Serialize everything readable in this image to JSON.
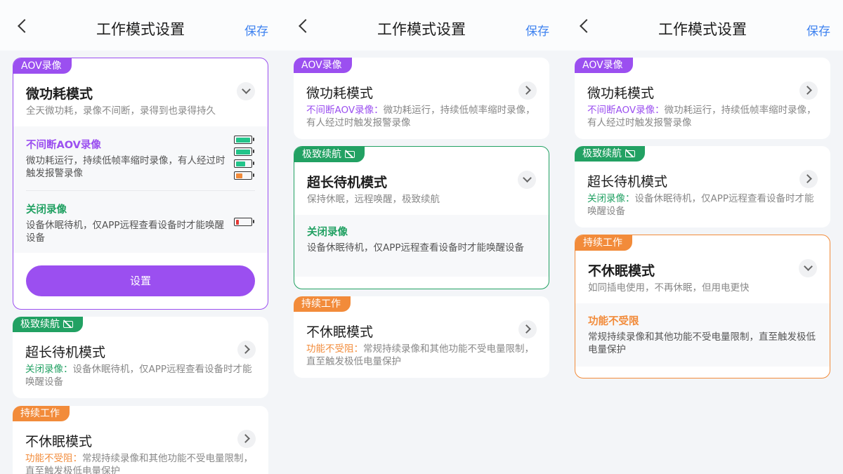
{
  "colors": {
    "purple": "#9b4ff0",
    "green": "#22a163",
    "orange": "#f28b3a",
    "link": "#3e82f0"
  },
  "nav": {
    "title": "工作模式设置",
    "save": "保存"
  },
  "aov": {
    "tag": "AOV录像",
    "title": "微功耗模式",
    "desc": "全天微功耗，录像不间断，录得到也录得持久",
    "highlight": "不间断AOV录像",
    "highlight_sep": "：",
    "summary": "微功耗运行，持续低帧率缩时录像，有人经过时触发报警录像",
    "opt1_title": "不间断AOV录像",
    "opt1_desc": "微功耗运行，持续低帧率缩时录像，有人经过时触发报警录像",
    "opt2_title": "关闭录像",
    "opt2_desc": "设备休眠待机，仅APP远程查看设备时才能唤醒设备",
    "button": "设置"
  },
  "standby": {
    "tag": "极致续航",
    "title": "超长待机模式",
    "desc": "保持休眠，远程唤醒，极致续航",
    "highlight": "关闭录像",
    "highlight_sep": "：",
    "summary": "设备休眠待机，仅APP远程查看设备时才能唤醒设备",
    "opt_title": "关闭录像",
    "opt_desc": "设备休眠待机，仅APP远程查看设备时才能唤醒设备"
  },
  "always": {
    "tag": "持续工作",
    "title": "不休眠模式",
    "desc": "如同插电使用，不再休眠，但用电更快",
    "highlight": "功能不受阻",
    "highlight_sep": "：",
    "summary": "常规持续录像和其他功能不受电量限制，直至触发极低电量保护",
    "opt_title": "功能不受限",
    "opt_desc": "常规持续录像和其他功能不受电量限制，直至触发极低电量保护"
  },
  "battery_icons": [
    "battery-full-icon",
    "battery-full-icon",
    "battery-medium-icon",
    "battery-low-orange-icon",
    "battery-empty-red-icon"
  ]
}
